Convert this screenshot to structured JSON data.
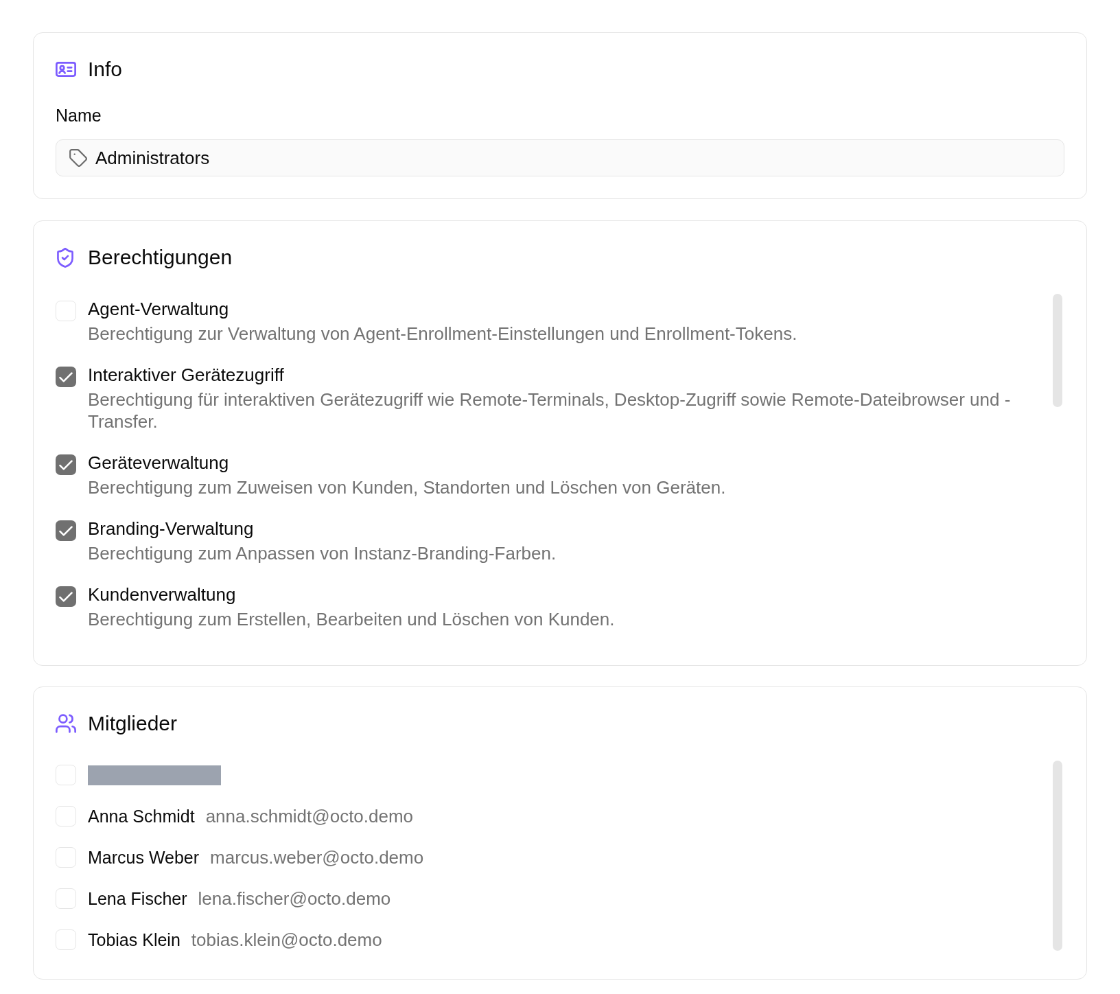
{
  "info": {
    "title": "Info",
    "name_field": {
      "label": "Name",
      "value": "Administrators"
    }
  },
  "permissions": {
    "title": "Berechtigungen",
    "items": [
      {
        "label": "Agent-Verwaltung",
        "description": "Berechtigung zur Verwaltung von Agent-Enrollment-Einstellungen und Enrollment-Tokens.",
        "checked": false
      },
      {
        "label": "Interaktiver Gerätezugriff",
        "description": "Berechtigung für interaktiven Gerätezugriff wie Remote-Terminals, Desktop-Zugriff sowie Remote-Dateibrowser und -Transfer.",
        "checked": true
      },
      {
        "label": "Geräteverwaltung",
        "description": "Berechtigung zum Zuweisen von Kunden, Standorten und Löschen von Geräten.",
        "checked": true
      },
      {
        "label": "Branding-Verwaltung",
        "description": "Berechtigung zum Anpassen von Instanz-Branding-Farben.",
        "checked": true
      },
      {
        "label": "Kundenverwaltung",
        "description": "Berechtigung zum Erstellen, Bearbeiten und Löschen von Kunden.",
        "checked": true
      }
    ]
  },
  "members": {
    "title": "Mitglieder",
    "items": [
      {
        "kind": "redacted",
        "checked": false
      },
      {
        "kind": "user",
        "name": "Anna Schmidt",
        "email": "anna.schmidt@octo.demo",
        "checked": false
      },
      {
        "kind": "user",
        "name": "Marcus Weber",
        "email": "marcus.weber@octo.demo",
        "checked": false
      },
      {
        "kind": "user",
        "name": "Lena Fischer",
        "email": "lena.fischer@octo.demo",
        "checked": false
      },
      {
        "kind": "user",
        "name": "Tobias Klein",
        "email": "tobias.klein@octo.demo",
        "checked": false
      }
    ]
  }
}
